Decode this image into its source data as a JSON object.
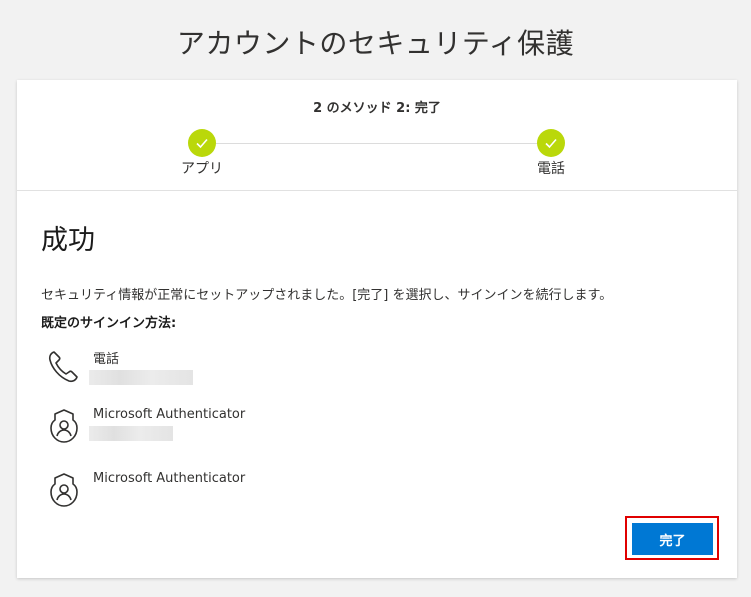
{
  "page": {
    "title": "アカウントのセキュリティ保護"
  },
  "progress": {
    "step_title": "2 のメソッド 2: 完了",
    "steps": [
      {
        "label": "アプリ",
        "status": "completed"
      },
      {
        "label": "電話",
        "status": "completed"
      }
    ]
  },
  "content": {
    "heading": "成功",
    "description": "セキュリティ情報が正常にセットアップされました。[完了] を選択し、サインインを続行します。",
    "default_method_label": "既定のサインイン方法:",
    "methods": [
      {
        "name": "電話",
        "icon": "phone-icon"
      },
      {
        "name": "Microsoft Authenticator",
        "icon": "authenticator-icon"
      },
      {
        "name": "Microsoft Authenticator",
        "icon": "authenticator-icon"
      }
    ]
  },
  "actions": {
    "done_label": "完了"
  },
  "colors": {
    "accent": "#0078d4",
    "success": "#bad80a",
    "highlight": "#e00000"
  }
}
